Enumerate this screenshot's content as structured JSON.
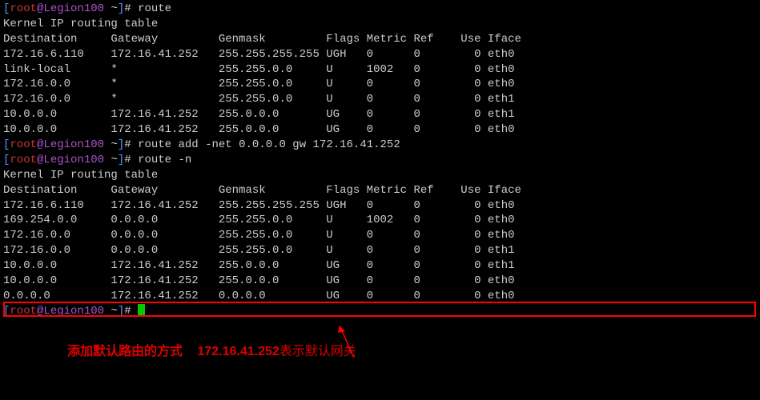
{
  "prompt1": {
    "open": "[",
    "user": "root",
    "at": "@",
    "host": "Legion100",
    "path": " ~",
    "close": "]",
    "sym": "# ",
    "cmd": "route"
  },
  "header1": "Kernel IP routing table",
  "cols": {
    "dest": "Destination",
    "gw": "Gateway",
    "mask": "Genmask",
    "flags": "Flags",
    "metric": "Metric",
    "ref": "Ref",
    "use": "Use",
    "iface": "Iface"
  },
  "t1": [
    {
      "dest": "172.16.6.110",
      "gw": "172.16.41.252",
      "mask": "255.255.255.255",
      "flags": "UGH",
      "metric": "0",
      "ref": "0",
      "use": "0",
      "iface": "eth0"
    },
    {
      "dest": "link-local",
      "gw": "*",
      "mask": "255.255.0.0",
      "flags": "U",
      "metric": "1002",
      "ref": "0",
      "use": "0",
      "iface": "eth0"
    },
    {
      "dest": "172.16.0.0",
      "gw": "*",
      "mask": "255.255.0.0",
      "flags": "U",
      "metric": "0",
      "ref": "0",
      "use": "0",
      "iface": "eth0"
    },
    {
      "dest": "172.16.0.0",
      "gw": "*",
      "mask": "255.255.0.0",
      "flags": "U",
      "metric": "0",
      "ref": "0",
      "use": "0",
      "iface": "eth1"
    },
    {
      "dest": "10.0.0.0",
      "gw": "172.16.41.252",
      "mask": "255.0.0.0",
      "flags": "UG",
      "metric": "0",
      "ref": "0",
      "use": "0",
      "iface": "eth1"
    },
    {
      "dest": "10.0.0.0",
      "gw": "172.16.41.252",
      "mask": "255.0.0.0",
      "flags": "UG",
      "metric": "0",
      "ref": "0",
      "use": "0",
      "iface": "eth0"
    }
  ],
  "prompt2_cmd": "route add -net 0.0.0.0 gw 172.16.41.252",
  "prompt3_cmd": "route -n",
  "header2": "Kernel IP routing table",
  "t2": [
    {
      "dest": "172.16.6.110",
      "gw": "172.16.41.252",
      "mask": "255.255.255.255",
      "flags": "UGH",
      "metric": "0",
      "ref": "0",
      "use": "0",
      "iface": "eth0"
    },
    {
      "dest": "169.254.0.0",
      "gw": "0.0.0.0",
      "mask": "255.255.0.0",
      "flags": "U",
      "metric": "1002",
      "ref": "0",
      "use": "0",
      "iface": "eth0"
    },
    {
      "dest": "172.16.0.0",
      "gw": "0.0.0.0",
      "mask": "255.255.0.0",
      "flags": "U",
      "metric": "0",
      "ref": "0",
      "use": "0",
      "iface": "eth0"
    },
    {
      "dest": "172.16.0.0",
      "gw": "0.0.0.0",
      "mask": "255.255.0.0",
      "flags": "U",
      "metric": "0",
      "ref": "0",
      "use": "0",
      "iface": "eth1"
    },
    {
      "dest": "10.0.0.0",
      "gw": "172.16.41.252",
      "mask": "255.0.0.0",
      "flags": "UG",
      "metric": "0",
      "ref": "0",
      "use": "0",
      "iface": "eth1"
    },
    {
      "dest": "10.0.0.0",
      "gw": "172.16.41.252",
      "mask": "255.0.0.0",
      "flags": "UG",
      "metric": "0",
      "ref": "0",
      "use": "0",
      "iface": "eth0"
    },
    {
      "dest": "0.0.0.0",
      "gw": "172.16.41.252",
      "mask": "0.0.0.0",
      "flags": "UG",
      "metric": "0",
      "ref": "0",
      "use": "0",
      "iface": "eth0"
    }
  ],
  "annotation": {
    "left": "添加默认路由的方式",
    "ip": "172.16.41.252",
    "right": "表示默认网关"
  }
}
